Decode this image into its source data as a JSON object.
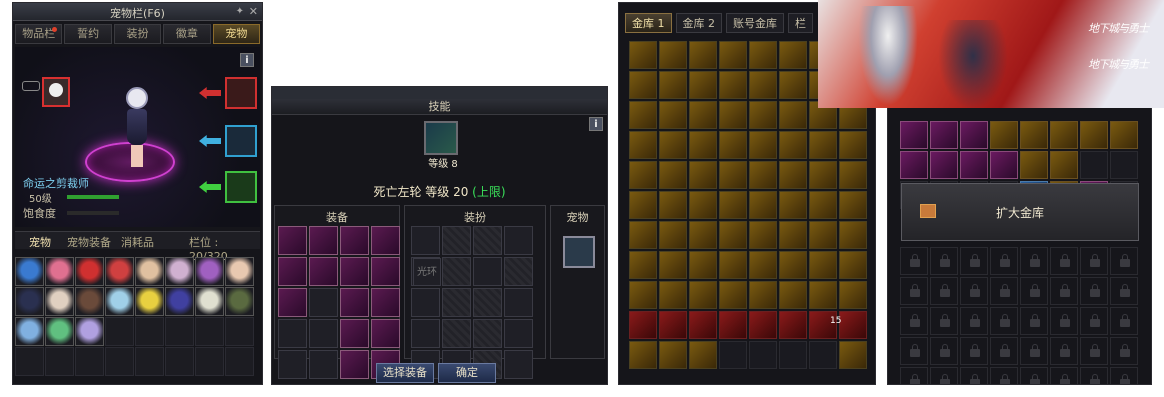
{
  "panel1": {
    "title": "宠物栏(F6)",
    "tabs": [
      "物品栏",
      "誓约",
      "装扮",
      "徽章",
      "宠物"
    ],
    "active_tab": "宠物",
    "pet_name": "命运之剪裁师",
    "pet_level": "50级",
    "satiety_label": "饱食度",
    "subtabs": [
      "宠物",
      "宠物装备",
      "消耗品"
    ],
    "slot_count": "栏位 : 20/320"
  },
  "panel2": {
    "skill_title": "技能",
    "skill_icon_level": "等级 8",
    "skill_name": "死亡左轮  等级 20",
    "skill_limit": "(上限)",
    "sections": [
      "装备",
      "装扮",
      "宠物"
    ],
    "light_slot": "光环",
    "buttons": {
      "select": "选择装备",
      "confirm": "确定"
    }
  },
  "panel3": {
    "tabs": [
      "金库 1",
      "金库 2",
      "账号金库",
      "栏"
    ],
    "active_tab": "金库 1",
    "stack_count": "15"
  },
  "panel4": {
    "expand_label": "扩大金库"
  },
  "banner": {
    "logo1": "地下城与勇士",
    "logo2": "地下城与勇士"
  },
  "colors": {
    "panel_bg": "#15151a",
    "tab_active": "#8a6a2a",
    "level_limit": "#3ae05a",
    "pet_name": "#7ed0f0"
  },
  "icons": {
    "info": "info-icon",
    "pin": "pin-icon",
    "close": "close-icon",
    "lock": "lock-icon",
    "expand": "vault-icon"
  }
}
